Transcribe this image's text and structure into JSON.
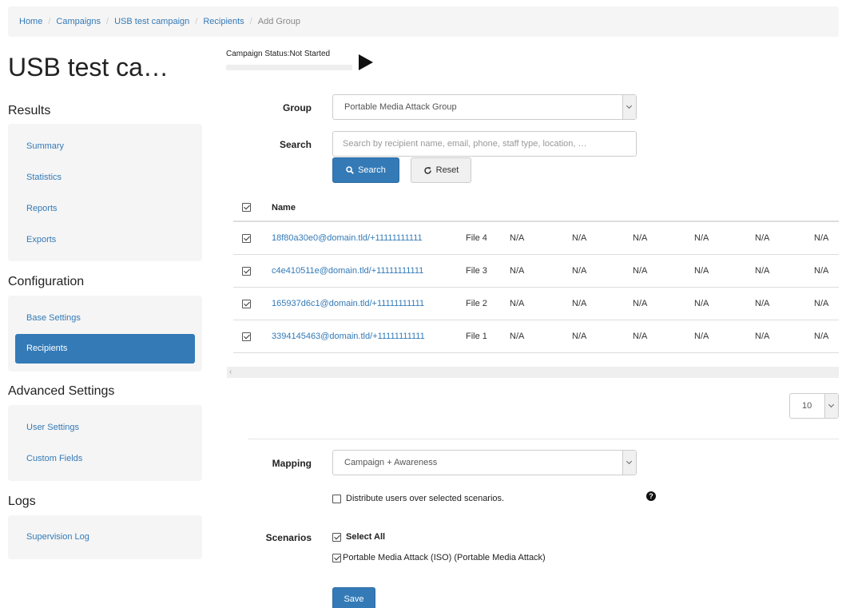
{
  "breadcrumb": [
    "Home",
    "Campaigns",
    "USB test campaign",
    "Recipients",
    "Add Group"
  ],
  "page_title": "USB test ca…",
  "campaign_status": "Campaign Status:Not Started",
  "sidebar": {
    "results_heading": "Results",
    "results_items": [
      "Summary",
      "Statistics",
      "Reports",
      "Exports"
    ],
    "configuration_heading": "Configuration",
    "configuration_items": [
      "Base Settings",
      "Recipients"
    ],
    "advanced_heading": "Advanced Settings",
    "advanced_items": [
      "User Settings",
      "Custom Fields"
    ],
    "logs_heading": "Logs",
    "logs_items": [
      "Supervision Log"
    ],
    "active_item": "Recipients"
  },
  "form": {
    "group_label": "Group",
    "group_value": "Portable Media Attack Group",
    "search_label": "Search",
    "search_placeholder": "Search by recipient name, email, phone, staff type, location, …",
    "search_button": "Search",
    "reset_button": "Reset"
  },
  "table": {
    "header_name": "Name",
    "rows": [
      {
        "name": "18f80a30e0@domain.tld/+11111111111",
        "file": "File 4",
        "cols": [
          "N/A",
          "N/A",
          "N/A",
          "N/A",
          "N/A",
          "N/A"
        ],
        "checked": true
      },
      {
        "name": "c4e410511e@domain.tld/+11111111111",
        "file": "File 3",
        "cols": [
          "N/A",
          "N/A",
          "N/A",
          "N/A",
          "N/A",
          "N/A"
        ],
        "checked": true
      },
      {
        "name": "165937d6c1@domain.tld/+11111111111",
        "file": "File 2",
        "cols": [
          "N/A",
          "N/A",
          "N/A",
          "N/A",
          "N/A",
          "N/A"
        ],
        "checked": true
      },
      {
        "name": "3394145463@domain.tld/+11111111111",
        "file": "File 1",
        "cols": [
          "N/A",
          "N/A",
          "N/A",
          "N/A",
          "N/A",
          "N/A"
        ],
        "checked": true
      }
    ]
  },
  "page_size": "10",
  "mapping": {
    "label": "Mapping",
    "value": "Campaign + Awareness",
    "distribute_label": "Distribute users over selected scenarios."
  },
  "scenarios": {
    "label": "Scenarios",
    "select_all": "Select All",
    "items": [
      "Portable Media Attack (ISO) (Portable Media Attack)"
    ]
  },
  "save_button": "Save",
  "colors": {
    "primary": "#337ab7",
    "panel": "#f5f5f5"
  }
}
